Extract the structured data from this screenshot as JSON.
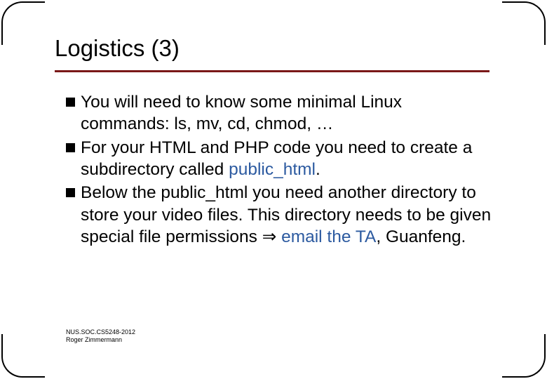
{
  "title": "Logistics (3)",
  "bullets": [
    {
      "segments": [
        {
          "text": "You will need to know some minimal Linux commands: ls, mv, cd, chmod, …"
        }
      ]
    },
    {
      "segments": [
        {
          "text": "For your HTML and PHP code you need to create a subdirectory called "
        },
        {
          "text": "public_html",
          "hl": true
        },
        {
          "text": "."
        }
      ]
    },
    {
      "segments": [
        {
          "text": "Below the public_html you need another directory to store your video files. This directory needs to be given special file permissions "
        },
        {
          "text": "⇒",
          "arrow": true
        },
        {
          "text": " "
        },
        {
          "text": "email the TA",
          "hl": true
        },
        {
          "text": ", Guanfeng."
        }
      ]
    }
  ],
  "footer": {
    "line1": "NUS.SOC.CS5248-2012",
    "line2": "Roger Zimmermann"
  }
}
